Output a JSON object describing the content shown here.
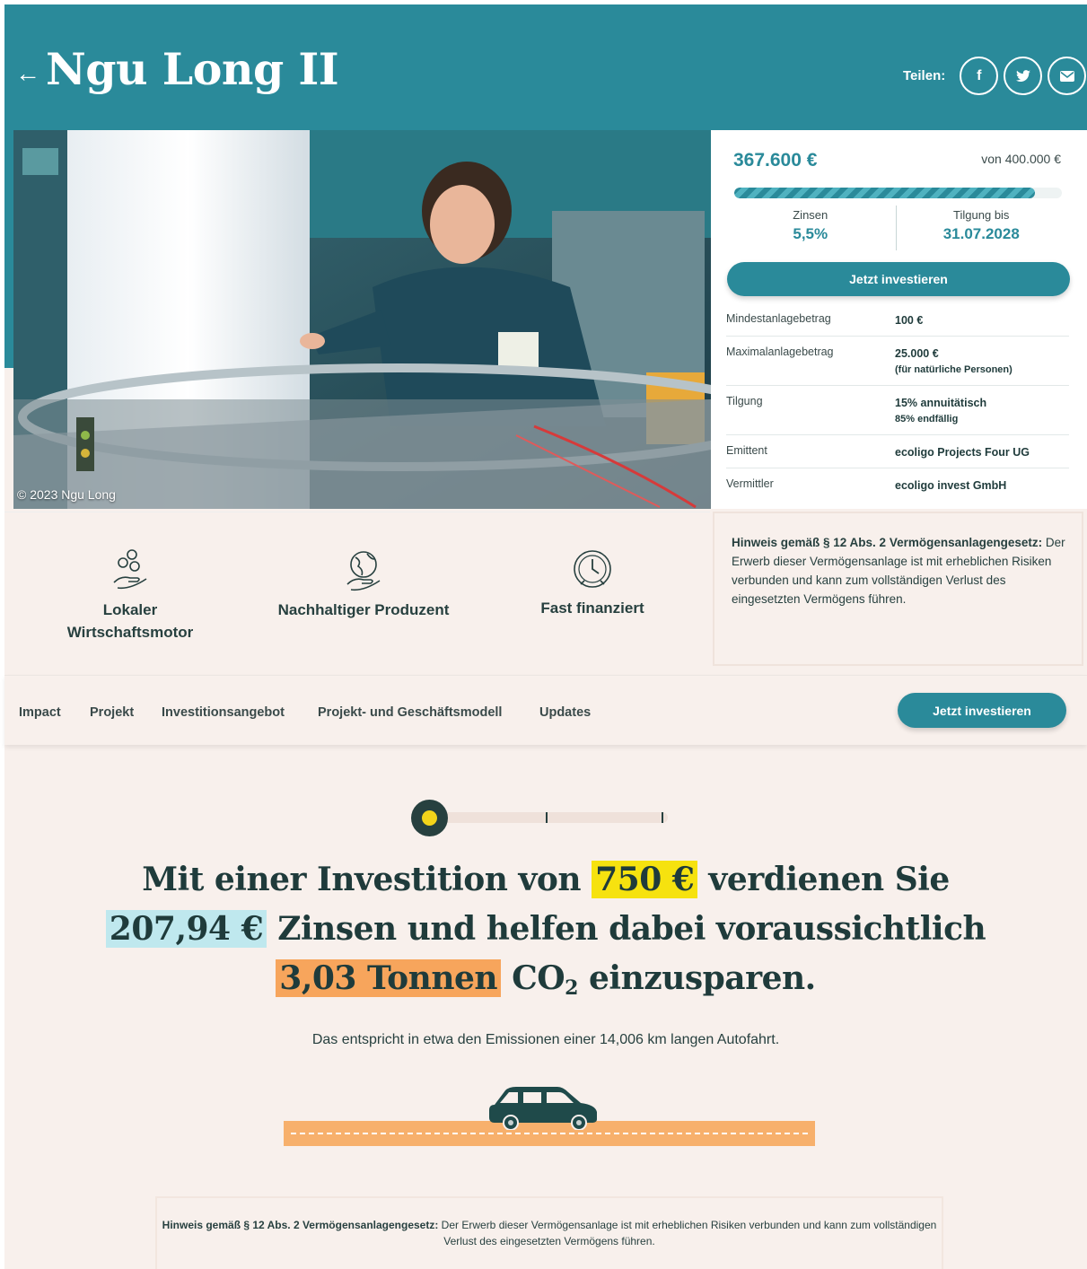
{
  "header": {
    "back_arrow": "←",
    "title": "Ngu Long II",
    "share_label": "Teilen:",
    "share_buttons": [
      {
        "icon": "facebook-icon",
        "glyph": "f"
      },
      {
        "icon": "twitter-icon",
        "glyph": "t"
      },
      {
        "icon": "email-icon",
        "glyph": "✉"
      }
    ]
  },
  "photo": {
    "credit": "© 2023 Ngu Long"
  },
  "funding": {
    "raised": "367.600 €",
    "goal": "von 400.000 €",
    "progress_fraction": 0.919,
    "interest_label": "Zinsen",
    "interest_value": "5,5%",
    "repayment_label": "Tilgung bis",
    "repayment_value": "31.07.2028",
    "invest_button": "Jetzt investieren",
    "terms": [
      {
        "label": "Mindestanlagebetrag",
        "value": "100 €",
        "sub": ""
      },
      {
        "label": "Maximalanlagebetrag",
        "value": "25.000 €",
        "sub": "(für natürliche Personen)"
      },
      {
        "label": "Tilgung",
        "value": "15% annuitätisch",
        "sub": "85% endfällig"
      },
      {
        "label": "Emittent",
        "value": "ecoligo Projects Four UG",
        "sub": ""
      },
      {
        "label": "Vermittler",
        "value": "ecoligo invest GmbH",
        "sub": ""
      }
    ]
  },
  "features": [
    {
      "icon": "coins-hand-icon",
      "label": "Lokaler Wirtschaftsmotor"
    },
    {
      "icon": "globe-hand-icon",
      "label": "Nachhaltiger Produzent"
    },
    {
      "icon": "clock-icon",
      "label": "Fast finanziert"
    }
  ],
  "hint": {
    "bold": "Hinweis gemäß § 12 Abs. 2 Vermögensanlagengesetz:",
    "text": " Der Erwerb dieser Vermögensanlage ist mit erheblichen Risiken verbunden und kann zum vollständigen Verlust des eingesetzten Vermögens führen."
  },
  "nav": {
    "items": [
      "Impact",
      "Projekt",
      "Investitionsangebot",
      "Projekt- und Geschäftsmodell",
      "Updates"
    ],
    "button": "Jetzt investieren"
  },
  "impact": {
    "part1": "Mit einer Investition von",
    "amount": "750 €",
    "part2": "verdienen Sie",
    "interest": "207,94 €",
    "part3": "Zinsen und helfen dabei voraussichtlich",
    "co2": "3,03 Tonnen",
    "co2_label": "CO",
    "co2_sub": "2",
    "part4": "einzusparen.",
    "equivalent": "Das entspricht in etwa den Emissionen einer 14,006 km langen Autofahrt.",
    "slider_position": 0
  },
  "bottom_hint": {
    "bold": "Hinweis gemäß § 12 Abs. 2 Vermögensanlagengesetz:",
    "text": " Der Erwerb dieser Vermögensanlage ist mit erheblichen Risiken verbunden und kann zum vollständigen Verlust des eingesetzten Vermögens führen."
  },
  "colors": {
    "brand": "#2a8a9a",
    "background": "#f8f0ec",
    "dark": "#1f3b3b",
    "highlight_yellow": "#f6e20f",
    "highlight_blue": "#bfe8ee",
    "highlight_orange": "#f7a55c"
  }
}
